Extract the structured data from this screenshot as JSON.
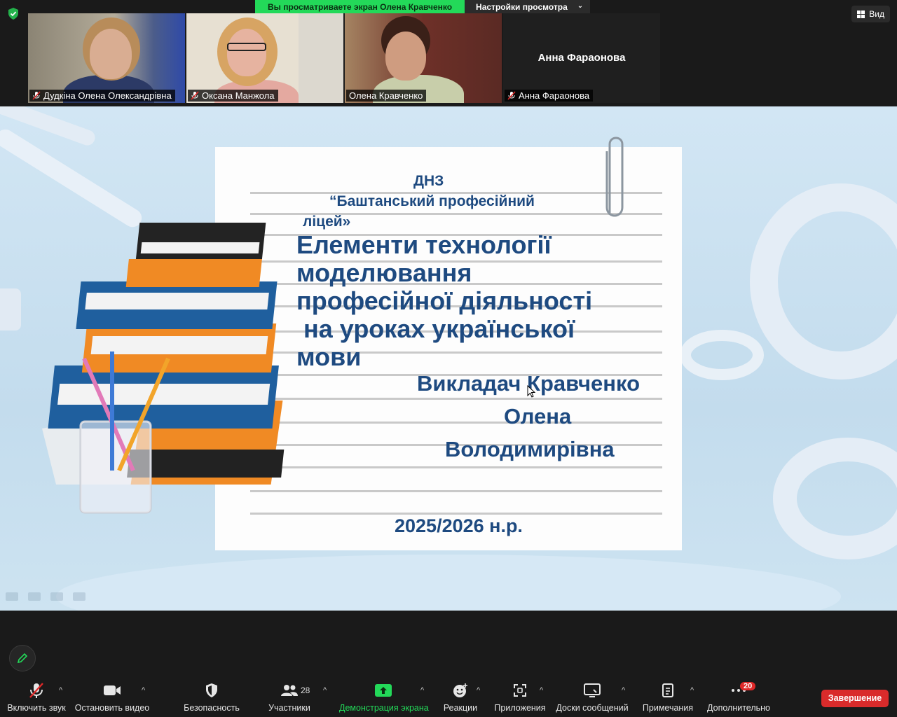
{
  "banner": {
    "sharing_text": "Вы просматриваете экран Олена Кравченко",
    "view_settings": "Настройки просмотра"
  },
  "view_button": {
    "label": "Вид"
  },
  "participants_strip": [
    {
      "name": "Дудкіна Олена Олександрівна",
      "muted": true
    },
    {
      "name": "Оксана Манжола",
      "muted": true
    },
    {
      "name": "Олена Кравченко",
      "muted": false,
      "active_speaker": true
    },
    {
      "name": "Анна Фараонова",
      "muted": true,
      "video_off_name": "Анна Фараонова"
    }
  ],
  "slide": {
    "org_line1": "ДНЗ",
    "org_line2": "“Баштанський професійний",
    "org_line3": "ліцей»",
    "title_line1": "Елементи технології",
    "title_line2": "моделювання",
    "title_line3": "професійної діяльності",
    "title_line4": " на уроках української",
    "title_line5": "мови",
    "author_line1": "Викладач Кравченко",
    "author_line2": "Олена",
    "author_line3": "Володимирівна",
    "year": "2025/2026 н.р."
  },
  "controls": {
    "audio": "Включить звук",
    "video": "Остановить видео",
    "security": "Безопасность",
    "participants": "Участники",
    "participants_count": "28",
    "share": "Демонстрация экрана",
    "reactions": "Реакции",
    "apps": "Приложения",
    "whiteboards": "Доски сообщений",
    "notes": "Примечания",
    "more": "Дополнительно",
    "more_badge": "20",
    "end": "Завершение"
  },
  "colors": {
    "share_green": "#23d959",
    "end_red": "#d92b2b",
    "slide_text": "#1e4a80",
    "active_speaker": "#c6e44a"
  }
}
